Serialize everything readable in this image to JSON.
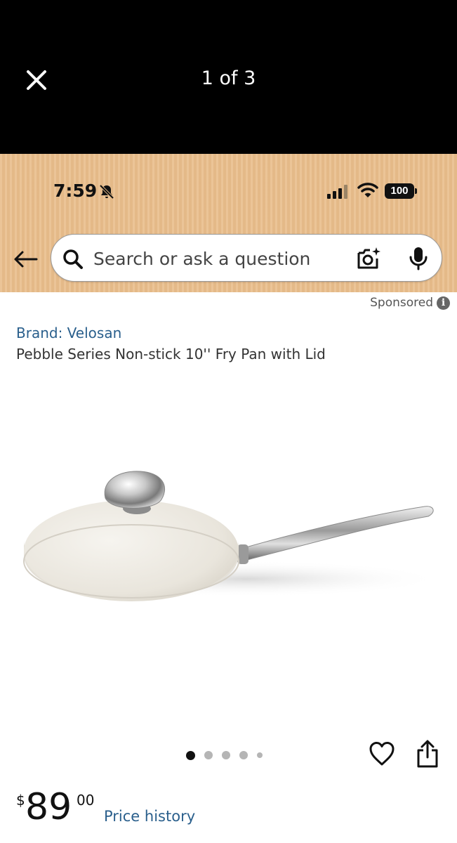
{
  "viewer": {
    "counter": "1 of 3"
  },
  "status_bar": {
    "time": "7:59",
    "battery": "100"
  },
  "search": {
    "placeholder": "Search or ask a question"
  },
  "sponsored_label": "Sponsored",
  "product": {
    "brand": "Brand: Velosan",
    "title": "Pebble Series Non-stick 10'' Fry Pan with Lid",
    "price_currency": "$",
    "price_whole": "89",
    "price_fraction": "00",
    "price_history_label": "Price history"
  },
  "carousel": {
    "active_index": 0,
    "dot_count": 5
  },
  "icons": {
    "close": "close-icon",
    "bell": "bell-slash-icon",
    "back": "arrow-left-icon",
    "search": "search-icon",
    "camera": "camera-sparkle-icon",
    "mic": "microphone-icon",
    "info": "info-icon",
    "heart": "heart-icon",
    "share": "share-icon"
  },
  "colors": {
    "header_bg": "#e9bd8b",
    "link": "#2a5f8c"
  }
}
